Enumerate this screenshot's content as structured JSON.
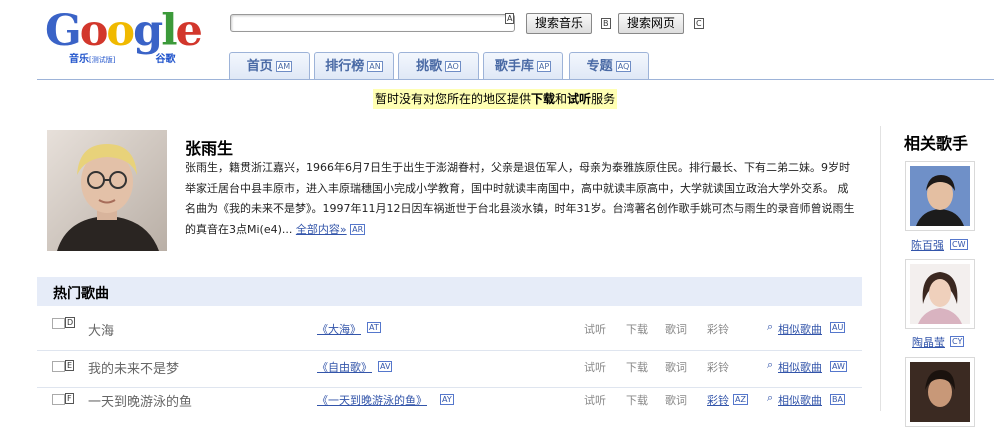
{
  "logo": {
    "word": "Google",
    "sub_left": "音乐",
    "sub_beta": "[测试版]",
    "sub_right": "谷歌",
    "colors": {
      "blue": "#3a63c7",
      "red": "#d2372c",
      "yellow": "#f0b900",
      "green": "#3c9a3a"
    }
  },
  "search": {
    "value": "",
    "input_key": "A",
    "music_button": "搜索音乐",
    "music_key": "B",
    "web_button": "搜索网页",
    "web_key": "C"
  },
  "tabs": [
    {
      "label": "首页",
      "key": "AM"
    },
    {
      "label": "排行榜",
      "key": "AN"
    },
    {
      "label": "挑歌",
      "key": "AO"
    },
    {
      "label": "歌手库",
      "key": "AP"
    },
    {
      "label": "专题",
      "key": "AQ"
    }
  ],
  "notice": {
    "prefix": "暂时没有对您所在的地区提供",
    "b1": "下载",
    "mid": "和",
    "b2": "试听",
    "suffix": "服务"
  },
  "artist": {
    "name": "张雨生",
    "bio": "张雨生，籍贯浙江嘉兴，1966年6月7日生于出生于澎湖眷村，父亲是退伍军人，母亲为泰雅族原住民。排行最长、下有二弟二妹。9岁时举家迁居台中县丰原市，进入丰原瑞穗国小完成小学教育，国中时就读丰南国中，高中就读丰原高中，大学就读国立政治大学外交系。 成名曲为《我的未来不是梦》。1997年11月12日因车祸逝世于台北县淡水镇，时年31岁。台湾著名创作歌手姚可杰与雨生的录音师曾说雨生的真音在3点Mi(e4)...",
    "more_link": "全部内容»",
    "more_key": "AR"
  },
  "hot_songs": {
    "title": "热门歌曲",
    "rows": [
      {
        "key": "D",
        "title": "大海",
        "album": "《大海》",
        "album_key": "AT",
        "listen": "试听",
        "download": "下载",
        "lyrics": "歌词",
        "ringtone": "彩铃",
        "ringtone_key": "",
        "similar": "相似歌曲",
        "similar_key": "AU"
      },
      {
        "key": "E",
        "title": "我的未来不是梦",
        "album": "《自由歌》",
        "album_key": "AV",
        "listen": "试听",
        "download": "下载",
        "lyrics": "歌词",
        "ringtone": "彩铃",
        "ringtone_key": "",
        "similar": "相似歌曲",
        "similar_key": "AW"
      },
      {
        "key": "F",
        "title": "一天到晚游泳的鱼",
        "album": "《一天到晚游泳的鱼》",
        "album_key": "AY",
        "listen": "试听",
        "download": "下载",
        "lyrics": "歌词",
        "ringtone": "彩铃",
        "ringtone_key": "AZ",
        "similar": "相似歌曲",
        "similar_key": "BA"
      }
    ]
  },
  "related": {
    "title": "相关歌手",
    "artists": [
      {
        "name": "陈百强",
        "key": "CW"
      },
      {
        "name": "陶晶莹",
        "key": "CY"
      },
      {
        "name": "",
        "key": ""
      }
    ]
  }
}
